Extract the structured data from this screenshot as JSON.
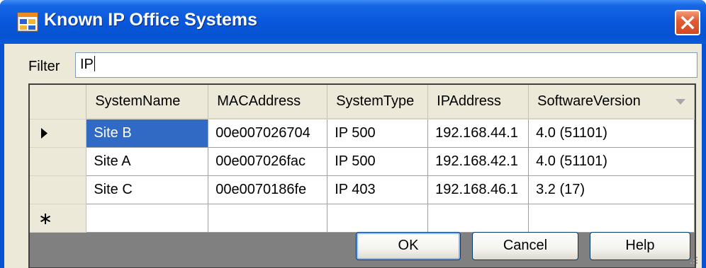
{
  "window": {
    "title": "Known IP Office Systems"
  },
  "filter": {
    "label": "Filter",
    "value": "IP"
  },
  "grid": {
    "columns": [
      "SystemName",
      "MACAddress",
      "SystemType",
      "IPAddress",
      "SoftwareVersion"
    ],
    "rows": [
      [
        "Site B",
        "00e007026704",
        "IP 500",
        "192.168.44.1",
        "4.0 (51101)"
      ],
      [
        "Site A",
        "00e007026fac",
        "IP 500",
        "192.168.42.1",
        "4.0 (51101)"
      ],
      [
        "Site C",
        "00e0070186fe",
        "IP 403",
        "192.168.46.1",
        "3.2 (17)"
      ]
    ],
    "new_row_marker": "∗"
  },
  "buttons": {
    "ok": "OK",
    "cancel": "Cancel",
    "help": "Help"
  },
  "icons": {
    "app": "app-window-icon",
    "close": "close-icon",
    "sort": "sort-descending-icon",
    "current_row": "current-row-arrow-icon",
    "new_row": "new-row-icon",
    "resize": "resize-grip-icon"
  },
  "colors": {
    "titlebar": "#0a58dc",
    "selection": "#316ac5",
    "dialog_bg": "#ece9d8",
    "close_button": "#e25d34"
  }
}
